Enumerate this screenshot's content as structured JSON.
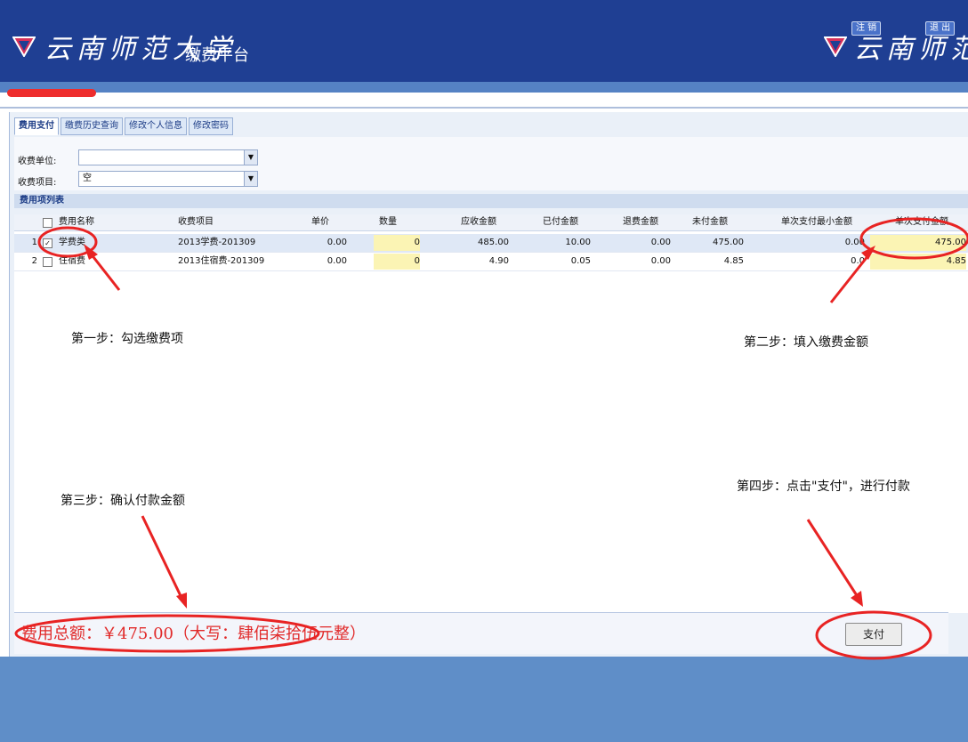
{
  "header": {
    "brand": "云南师范大学",
    "platform": "缴费平台",
    "brand_right": "云南师范大",
    "logout_label": "注 销",
    "exit_label": "退 出"
  },
  "tabs": [
    "费用支付",
    "缴费历史查询",
    "修改个人信息",
    "修改密码"
  ],
  "form": {
    "unit_label": "收费单位:",
    "unit_value": "",
    "item_label": "收费项目:",
    "item_value": "空"
  },
  "table": {
    "title": "费用项列表",
    "columns": [
      "费用名称",
      "收费项目",
      "单价",
      "数量",
      "应收金额",
      "已付金额",
      "退费金额",
      "未付金额",
      "单次支付最小金额",
      "单次支付金额"
    ],
    "rows": [
      {
        "index": "1",
        "checked": "✓",
        "name": "学费类",
        "item": "2013学费-201309",
        "price": "0.00",
        "qty": "0",
        "receivable": "485.00",
        "paid": "10.00",
        "refund": "0.00",
        "unpaid": "475.00",
        "min": "0.00",
        "pay": "475.00"
      },
      {
        "index": "2",
        "checked": "",
        "name": "住宿费",
        "item": "2013住宿费-201309",
        "price": "0.00",
        "qty": "0",
        "receivable": "4.90",
        "paid": "0.05",
        "refund": "0.00",
        "unpaid": "4.85",
        "min": "0.0",
        "pay": "4.85"
      }
    ]
  },
  "annotations": {
    "step1": "第一步：勾选缴费项",
    "step2": "第二步：填入缴费金额",
    "step3": "第三步：确认付款金额",
    "step4": "第四步：点击\"支付\"，进行付款"
  },
  "footer": {
    "total": "费用总额：￥475.00（大写：肆佰柒拾伍元整）",
    "pay_label": "支付"
  },
  "colors": {
    "header": "#1f3f93",
    "annotation_red": "#e12a2a",
    "bottom": "#5f8ec8"
  }
}
